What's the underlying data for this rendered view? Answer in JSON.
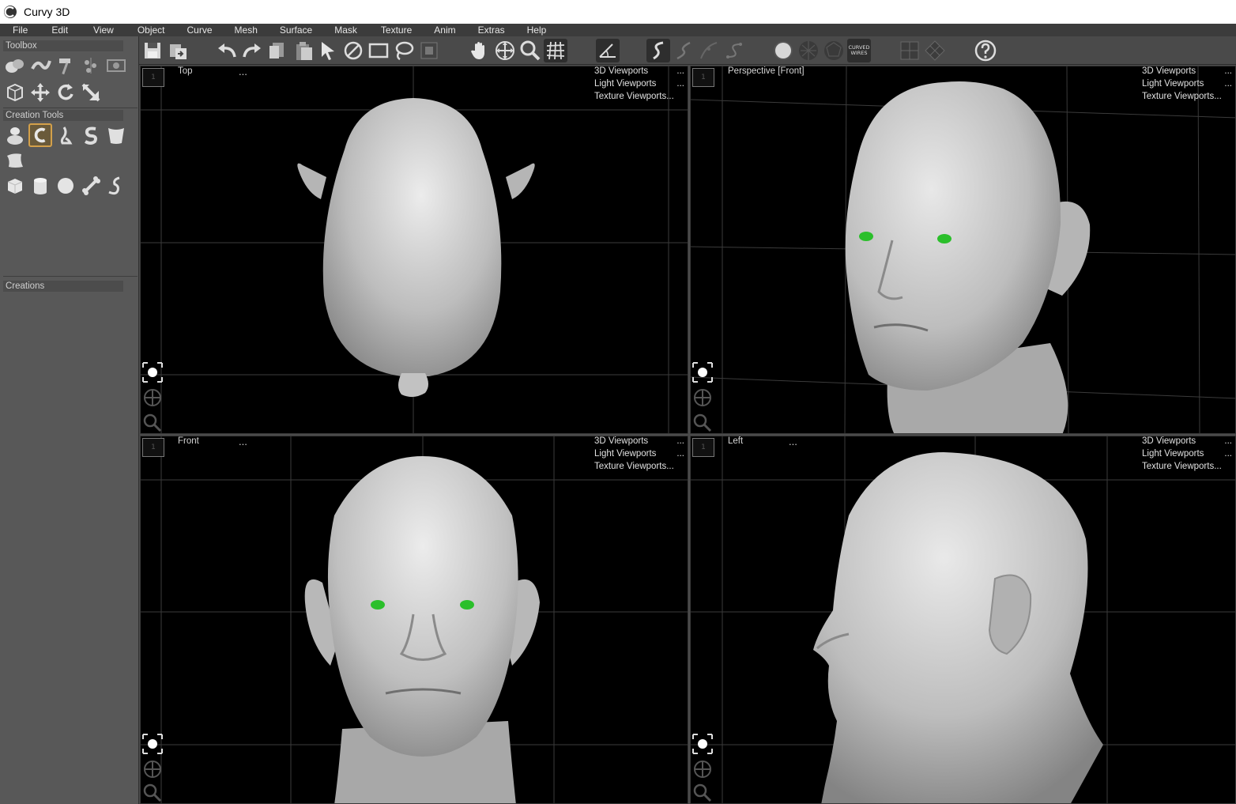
{
  "window": {
    "title": "Curvy 3D"
  },
  "menu": [
    "File",
    "Edit",
    "View",
    "Object",
    "Curve",
    "Mesh",
    "Surface",
    "Mask",
    "Texture",
    "Anim",
    "Extras",
    "Help"
  ],
  "sidebar": {
    "toolbox_label": "Toolbox",
    "creation_tools_label": "Creation Tools",
    "creations_label": "Creations"
  },
  "toolbar": {
    "curved_wires_label": "CURVED\nWIRES"
  },
  "viewports": {
    "options": [
      "3D Viewports",
      "Light Viewports",
      "Texture Viewports..."
    ],
    "top": {
      "title": "Top",
      "dots": "...",
      "number": "1"
    },
    "perspective": {
      "title": "Perspective [Front]",
      "dots": "",
      "number": "1"
    },
    "front": {
      "title": "Front",
      "dots": "...",
      "number": "1"
    },
    "left": {
      "title": "Left",
      "dots": "...",
      "number": "1"
    }
  },
  "colors": {
    "eye": "#2bbf2b",
    "skin": "#c9c9c9",
    "grid": "#3a3a3a",
    "accent": "#d3a04a"
  }
}
